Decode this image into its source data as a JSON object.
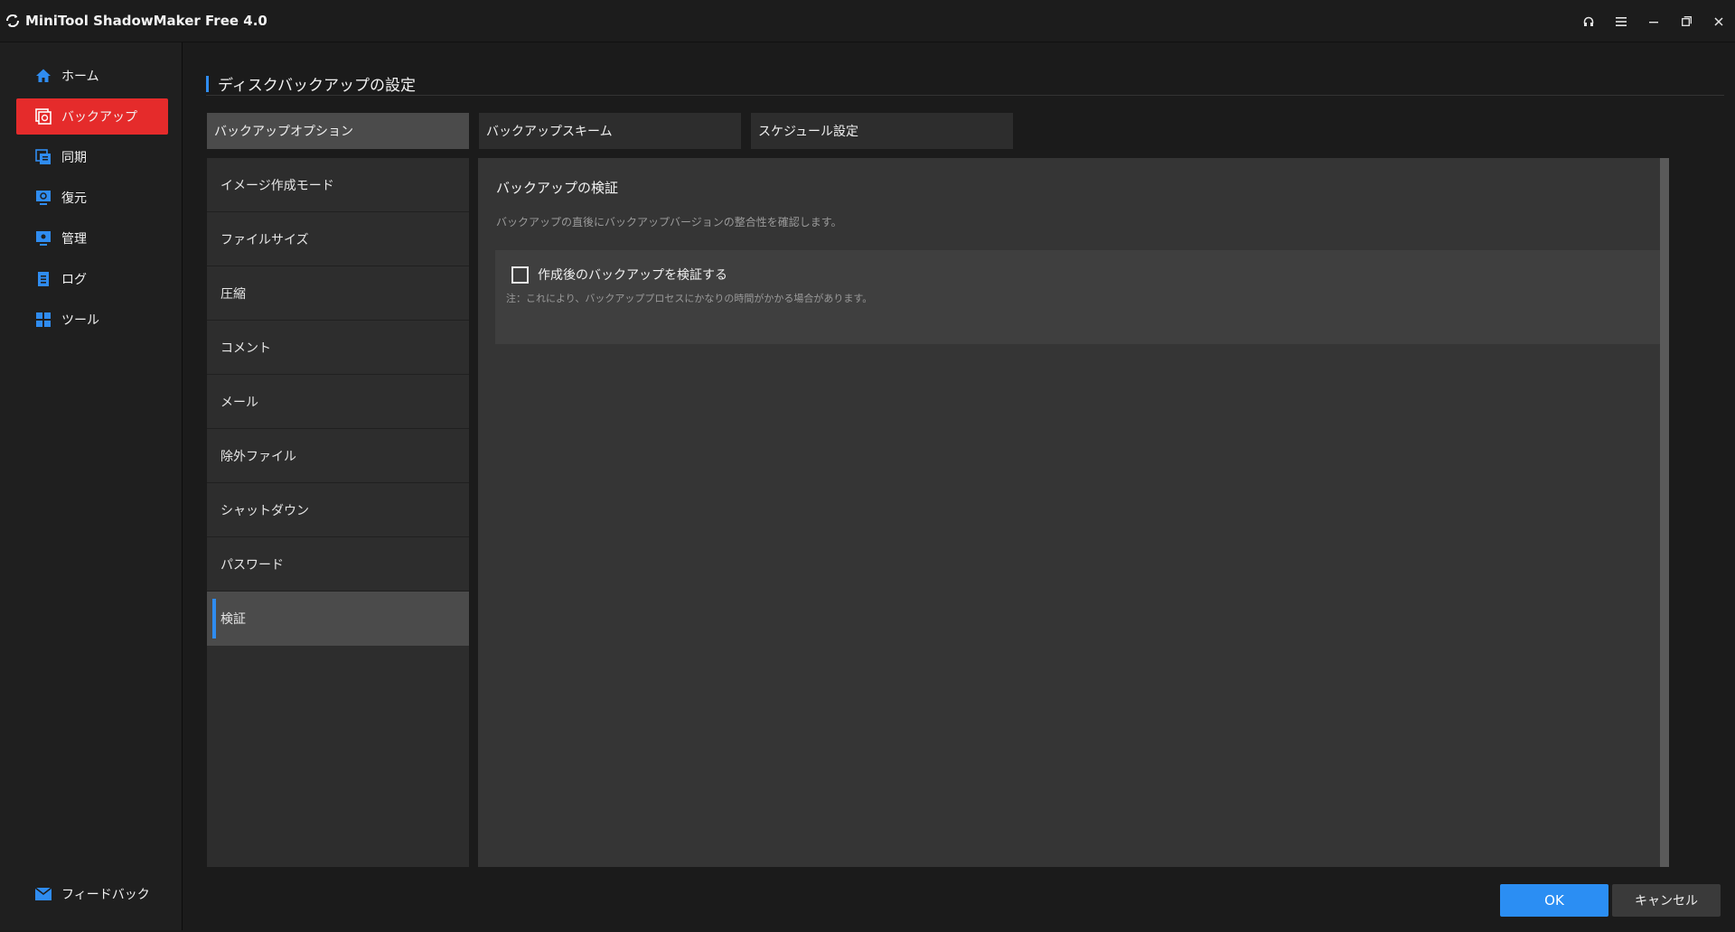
{
  "window": {
    "title": "MiniTool ShadowMaker Free 4.0",
    "controls": [
      {
        "name": "support-button",
        "icon": "headset-icon"
      },
      {
        "name": "menu-button",
        "icon": "hamburger-menu-icon"
      },
      {
        "name": "minimize-button",
        "icon": "minimize-icon"
      },
      {
        "name": "restore-button",
        "icon": "restore-icon"
      },
      {
        "name": "close-button",
        "icon": "close-icon"
      }
    ]
  },
  "sidebar": {
    "items": [
      {
        "label": "ホーム",
        "icon": "home-icon",
        "active": false
      },
      {
        "label": "バックアップ",
        "icon": "backup-icon",
        "active": true
      },
      {
        "label": "同期",
        "icon": "sync-icon",
        "active": false
      },
      {
        "label": "復元",
        "icon": "restore-icon",
        "active": false
      },
      {
        "label": "管理",
        "icon": "manage-icon",
        "active": false
      },
      {
        "label": "ログ",
        "icon": "log-icon",
        "active": false
      },
      {
        "label": "ツール",
        "icon": "tools-icon",
        "active": false
      }
    ],
    "feedback": {
      "label": "フィードバック",
      "icon": "mail-icon"
    }
  },
  "main": {
    "title": "ディスクバックアップの設定",
    "tabs": [
      {
        "label": "バックアップオプション",
        "active": true
      },
      {
        "label": "バックアップスキーム",
        "active": false
      },
      {
        "label": "スケジュール設定",
        "active": false
      }
    ],
    "options": [
      {
        "label": "イメージ作成モード",
        "active": false
      },
      {
        "label": "ファイルサイズ",
        "active": false
      },
      {
        "label": "圧縮",
        "active": false
      },
      {
        "label": "コメント",
        "active": false
      },
      {
        "label": "メール",
        "active": false
      },
      {
        "label": "除外ファイル",
        "active": false
      },
      {
        "label": "シャットダウン",
        "active": false
      },
      {
        "label": "パスワード",
        "active": false
      },
      {
        "label": "検証",
        "active": true
      }
    ],
    "panel": {
      "heading": "バックアップの検証",
      "description": "バックアップの直後にバックアップバージョンの整合性を確認します。",
      "checkbox_label": "作成後のバックアップを検証する",
      "checkbox_checked": false,
      "note": "注：これにより、バックアッププロセスにかなりの時間がかかる場合があります。"
    },
    "buttons": {
      "ok": "OK",
      "cancel": "キャンセル"
    }
  },
  "colors": {
    "accent_blue": "#2f8cf0",
    "active_red": "#e52b2b",
    "ok_button": "#2b8ef3"
  }
}
